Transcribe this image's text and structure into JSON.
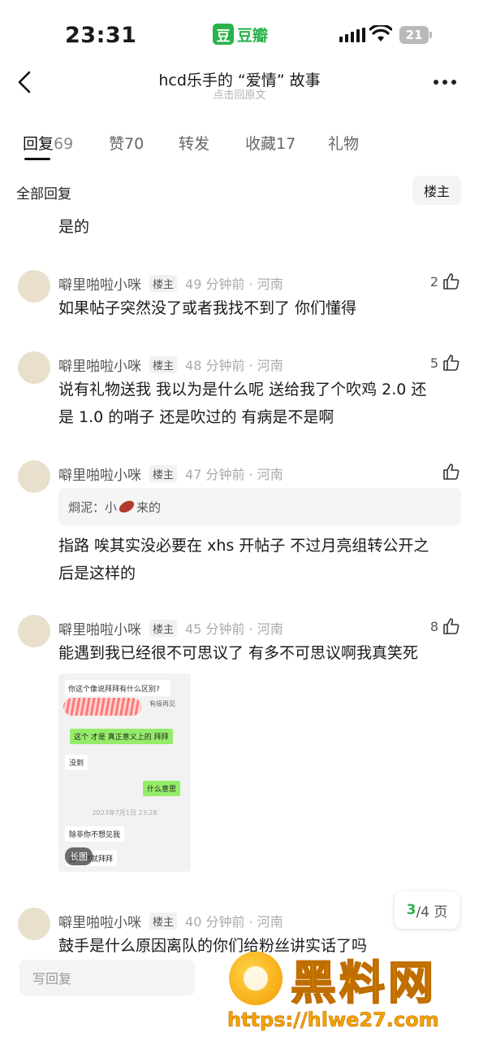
{
  "status_bar": {
    "time": "23:31",
    "app_name": "豆瓣",
    "app_logo_char": "豆",
    "battery": "21"
  },
  "nav": {
    "title": "hcd乐手的 “爱情” 故事",
    "subtitle": "点击回原文"
  },
  "tabs": [
    {
      "label": "回复",
      "count": "69"
    },
    {
      "label": "赞",
      "count": "70"
    },
    {
      "label": "转发",
      "count": ""
    },
    {
      "label": "收藏",
      "count": "17"
    },
    {
      "label": "礼物",
      "count": ""
    }
  ],
  "filter": {
    "all_replies": "全部回复",
    "op_only": "楼主"
  },
  "orphan_text": "是的",
  "comments": [
    {
      "user": "噼里啪啦小咪",
      "badge": "楼主",
      "time": "49 分钟前 · 河南",
      "likes": "2",
      "lines": [
        "如果帖子突然没了或者我找不到了 你们懂得"
      ]
    },
    {
      "user": "噼里啪啦小咪",
      "badge": "楼主",
      "time": "48 分钟前 · 河南",
      "likes": "5",
      "lines": [
        "说有礼物送我 我以为是什么呢 送给我了个吹鸡 2.0 还",
        "是 1.0 的哨子 还是吹过的 有病是不是啊"
      ]
    },
    {
      "user": "噼里啪啦小咪",
      "badge": "楼主",
      "time": "47 分钟前 · 河南",
      "likes": "",
      "quote_prefix": "烱泥：小",
      "quote_suffix": "来的",
      "lines": [
        "指路 唉其实没必要在 xhs 开帖子 不过月亮组转公开之",
        "后是这样的"
      ]
    },
    {
      "user": "噼里啪啦小咪",
      "badge": "楼主",
      "time": "45 分钟前 · 河南",
      "likes": "8",
      "lines": [
        "能遇到我已经很不可思议了 有多不可思议啊我真笑死"
      ]
    },
    {
      "user": "噼里啪啦小咪",
      "badge": "楼主",
      "time": "40 分钟前 · 河南",
      "likes": "",
      "lines": [
        "鼓手是什么原因离队的你们给粉丝讲实话了吗"
      ]
    }
  ],
  "chat_image": {
    "question": "你这个像说拜拜有什么区别?",
    "side_label": "有缘再见",
    "green1": "这个 才是 真正意义上的 拜拜",
    "white1": "没到",
    "green2": "什么意思",
    "timestamp": "2023年7月1日 23:28",
    "white2": "除非你不想见我",
    "white3": "要不然就拜拜",
    "long_image_label": "长图"
  },
  "pager": {
    "current": "3",
    "total": "/4 页"
  },
  "reply_placeholder": "写回复",
  "watermark": {
    "title": "黑料网",
    "url": "https://hlwe27.com"
  },
  "colors": {
    "brand_green": "#2ab24b",
    "watermark_orange": "#f5a300"
  }
}
